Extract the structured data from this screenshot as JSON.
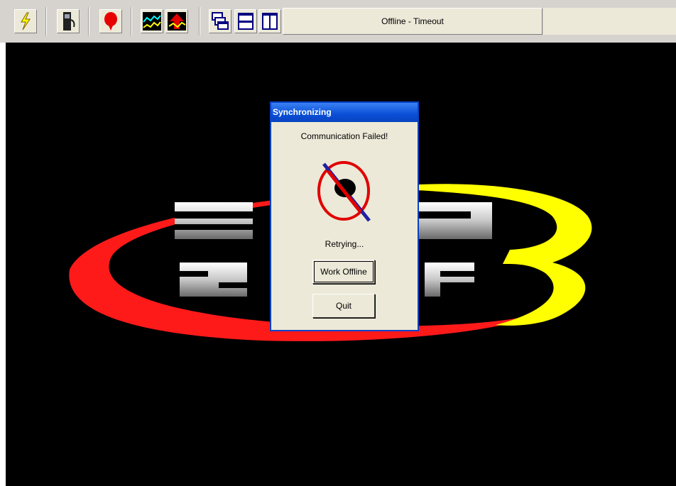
{
  "toolbar": {
    "buttons": [
      {
        "icon": "lightning-icon"
      },
      {
        "icon": "fuel-pump-icon"
      },
      {
        "icon": "balloon-icon"
      },
      {
        "icon": "chart-icon"
      },
      {
        "icon": "upload-arrow-icon"
      },
      {
        "icon": "cascade-windows-icon"
      },
      {
        "icon": "tile-horizontal-icon"
      },
      {
        "icon": "tile-vertical-icon"
      }
    ],
    "status_text": "Offline - Timeout"
  },
  "dialog": {
    "title": "Synchronizing",
    "message": "Communication Failed!",
    "icon": "disconnected-plug-icon",
    "status": "Retrying...",
    "work_offline_label": "Work Offline",
    "quit_label": "Quit"
  },
  "colors": {
    "titlebar": "#0a4fd6",
    "viewport_bg": "#000000",
    "logo_red": "#ff1a1a",
    "logo_yellow": "#ffff00"
  }
}
